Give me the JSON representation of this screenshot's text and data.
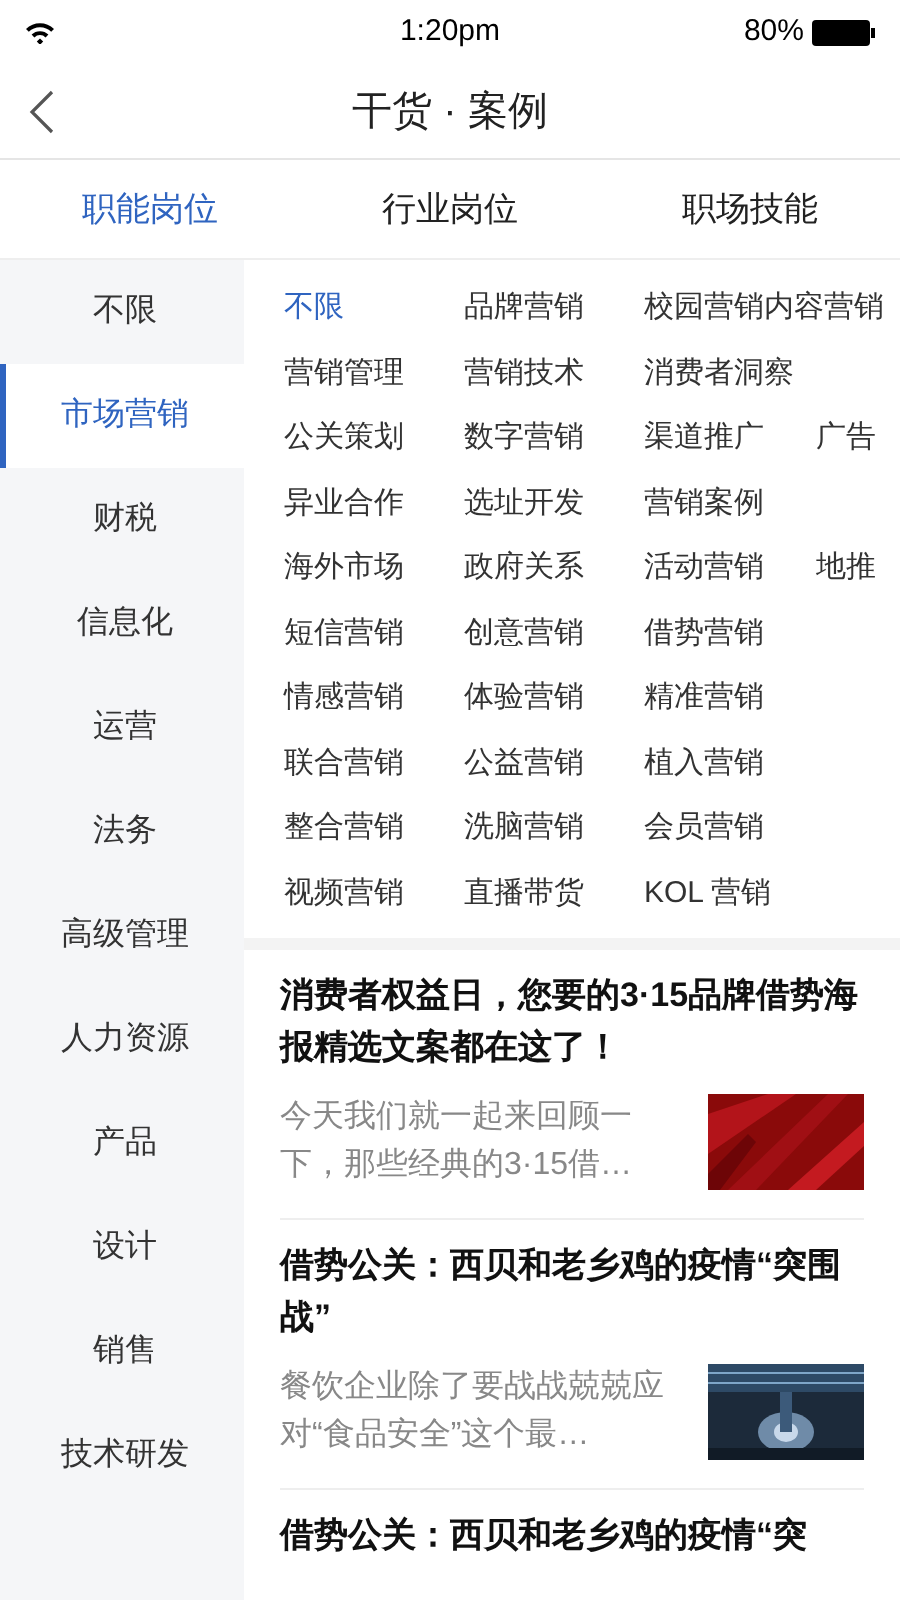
{
  "status_bar": {
    "time": "1:20pm",
    "battery": "80%"
  },
  "nav": {
    "title": "干货 · 案例"
  },
  "tabs": [
    {
      "label": "职能岗位",
      "selected": true
    },
    {
      "label": "行业岗位",
      "selected": false
    },
    {
      "label": "职场技能",
      "selected": false
    }
  ],
  "sidebar": {
    "items": [
      {
        "label": "不限",
        "selected": false
      },
      {
        "label": "市场营销",
        "selected": true
      },
      {
        "label": "财税",
        "selected": false
      },
      {
        "label": "信息化",
        "selected": false
      },
      {
        "label": "运营",
        "selected": false
      },
      {
        "label": "法务",
        "selected": false
      },
      {
        "label": "高级管理",
        "selected": false
      },
      {
        "label": "人力资源",
        "selected": false
      },
      {
        "label": "产品",
        "selected": false
      },
      {
        "label": "设计",
        "selected": false
      },
      {
        "label": "销售",
        "selected": false
      },
      {
        "label": "技术研发",
        "selected": false
      }
    ]
  },
  "tag_rows": [
    [
      {
        "label": "不限",
        "selected": true
      },
      {
        "label": "品牌营销",
        "selected": false
      },
      {
        "label": "校园营销",
        "selected": false
      },
      {
        "label": "内容营销",
        "selected": false
      }
    ],
    [
      {
        "label": "营销管理",
        "selected": false
      },
      {
        "label": "营销技术",
        "selected": false
      },
      {
        "label": "消费者洞察",
        "selected": false
      }
    ],
    [
      {
        "label": "公关策划",
        "selected": false
      },
      {
        "label": "数字营销",
        "selected": false
      },
      {
        "label": "渠道推广",
        "selected": false
      },
      {
        "label": "广告",
        "selected": false
      }
    ],
    [
      {
        "label": "异业合作",
        "selected": false
      },
      {
        "label": "选址开发",
        "selected": false
      },
      {
        "label": "营销案例",
        "selected": false
      }
    ],
    [
      {
        "label": "海外市场",
        "selected": false
      },
      {
        "label": "政府关系",
        "selected": false
      },
      {
        "label": "活动营销",
        "selected": false
      },
      {
        "label": "地推",
        "selected": false
      }
    ],
    [
      {
        "label": "短信营销",
        "selected": false
      },
      {
        "label": "创意营销",
        "selected": false
      },
      {
        "label": "借势营销",
        "selected": false
      }
    ],
    [
      {
        "label": "情感营销",
        "selected": false
      },
      {
        "label": "体验营销",
        "selected": false
      },
      {
        "label": "精准营销",
        "selected": false
      }
    ],
    [
      {
        "label": "联合营销",
        "selected": false
      },
      {
        "label": "公益营销",
        "selected": false
      },
      {
        "label": "植入营销",
        "selected": false
      }
    ],
    [
      {
        "label": "整合营销",
        "selected": false
      },
      {
        "label": "洗脑营销",
        "selected": false
      },
      {
        "label": "会员营销",
        "selected": false
      }
    ],
    [
      {
        "label": "视频营销",
        "selected": false
      },
      {
        "label": "直播带货",
        "selected": false
      },
      {
        "label": "KOL 营销",
        "selected": false
      }
    ]
  ],
  "articles": [
    {
      "title": "消费者权益日，您要的3·15品牌借势海报精选文案都在这了！",
      "excerpt": "今天我们就一起来回顾一下，那些经典的3·15借…"
    },
    {
      "title": "借势公关：西贝和老乡鸡的疫情“突围战”",
      "excerpt": "餐饮企业除了要战战兢兢应对“食品安全”这个最…"
    },
    {
      "title": "借势公关：西贝和老乡鸡的疫情“突"
    }
  ]
}
